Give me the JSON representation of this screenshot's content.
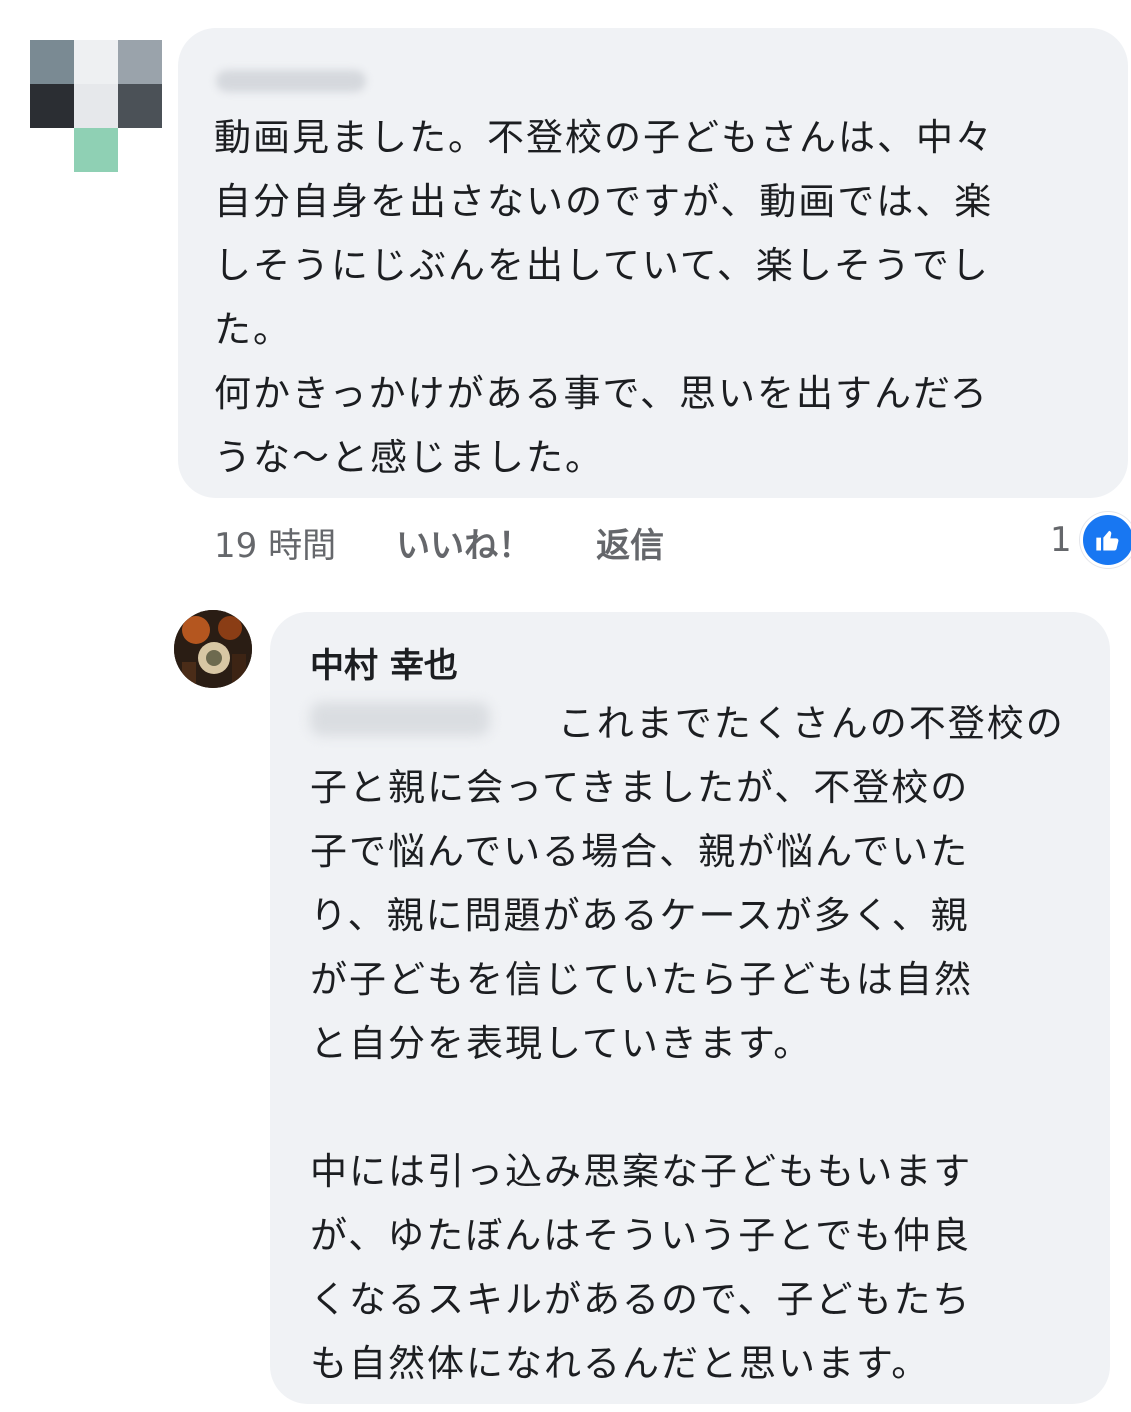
{
  "comments": [
    {
      "text": "動画見ました。不登校の子どもさんは、中々\n自分自身を出さないのですが、動画では、楽\nしそうにじぶんを出していて、楽しそうでし\nた。\n何かきっかけがある事で、思いを出すんだろ\nうな〜と感じました。",
      "time": "19 時間",
      "like_label": "いいね！",
      "reply_label": "返信",
      "reaction_count": "1",
      "reaction_icon": "thumbs-up-icon"
    },
    {
      "author": "中村 幸也",
      "text": "　　　　　　 これまでたくさんの不登校の\n子と親に会ってきましたが、不登校の\n子で悩んでいる場合、親が悩んでいた\nり、親に問題があるケースが多く、親\nが子どもを信じていたら子どもは自然\nと自分を表現していきます。\n\n中には引っ込み思案な子どももいます\nが、ゆたぼんはそういう子とでも仲良\nくなるスキルがあるので、子どもたち\nも自然体になれるんだと思います。"
    }
  ],
  "colors": {
    "bubble": "#f0f2f5",
    "text": "#1c1e21",
    "secondary": "#65676b",
    "like_blue": "#1877f2"
  }
}
